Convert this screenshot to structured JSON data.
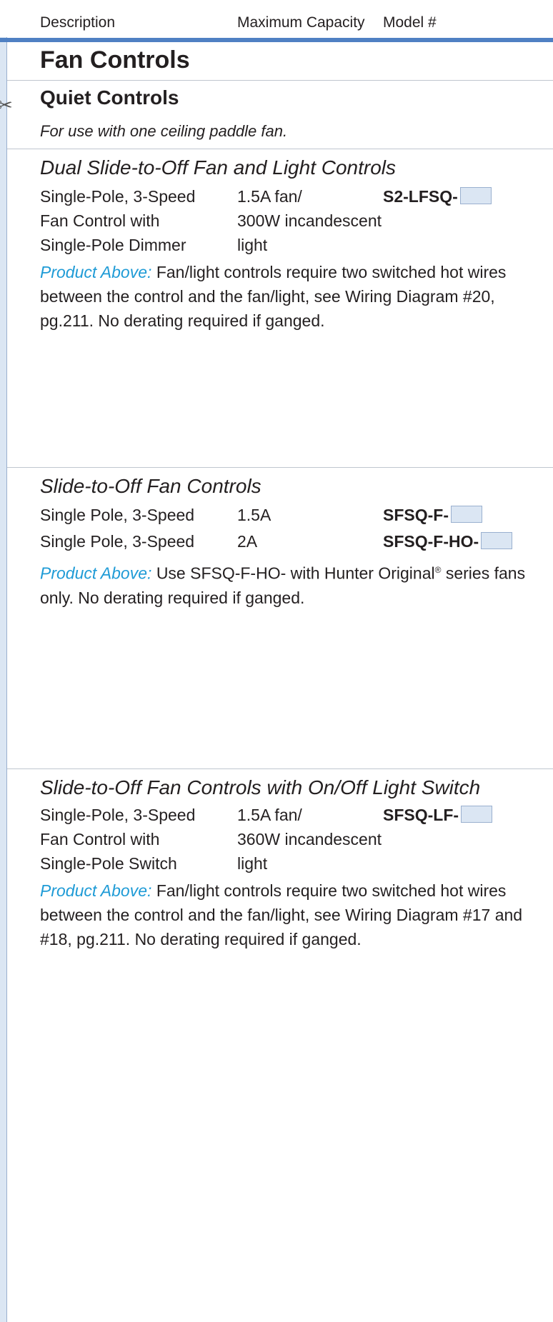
{
  "header": {
    "col_description": "Description",
    "col_capacity": "Maximum Capacity",
    "col_model": "Model #"
  },
  "page_title": "Fan Controls",
  "subsection": {
    "title": "Quiet Controls",
    "note": "For use with one ceiling paddle fan."
  },
  "label_product_above": "Product Above:",
  "sections": [
    {
      "title": "Dual Slide-to-Off Fan and Light Controls",
      "rows": [
        {
          "description": "Single-Pole, 3-Speed",
          "capacity": "1.5A fan/",
          "model": "S2-LFSQ-"
        },
        {
          "description": "Fan Control with",
          "capacity": "300W incandescent",
          "model": ""
        },
        {
          "description": "Single-Pole Dimmer",
          "capacity": "light",
          "model": ""
        }
      ],
      "product_note": "Fan/light controls require two switched hot wires between the control and the fan/light, see Wiring Diagram #20, pg.211. No derating required if ganged."
    },
    {
      "title": "Slide-to-Off Fan Controls",
      "rows": [
        {
          "description": "Single Pole, 3-Speed",
          "capacity": "1.5A",
          "model": "SFSQ-F-"
        },
        {
          "description": "Single Pole, 3-Speed",
          "capacity": "2A",
          "model": "SFSQ-F-HO-"
        }
      ],
      "product_note_part1": "Use SFSQ-F-HO- with Hunter Original",
      "product_note_reg": "®",
      "product_note_part2": " series fans only. No derating required if ganged."
    },
    {
      "title": "Slide-to-Off Fan Controls with On/Off Light Switch",
      "rows": [
        {
          "description": "Single-Pole, 3-Speed",
          "capacity": "1.5A fan/",
          "model": "SFSQ-LF-"
        },
        {
          "description": "Fan Control with",
          "capacity": "360W incandescent",
          "model": ""
        },
        {
          "description": "Single-Pole Switch",
          "capacity": "light",
          "model": ""
        }
      ],
      "product_note": "Fan/light controls require two switched hot wires between the control and the fan/light, see Wiring Diagram #17 and #18, pg.211. No derating required if ganged."
    }
  ],
  "icons": {
    "scissors": "scissors-icon"
  },
  "colors": {
    "accent_rule": "#4f80c3",
    "sidebar": "#dbe6f3",
    "product_above": "#1f9bd6",
    "swatch": "#dbe6f3"
  }
}
